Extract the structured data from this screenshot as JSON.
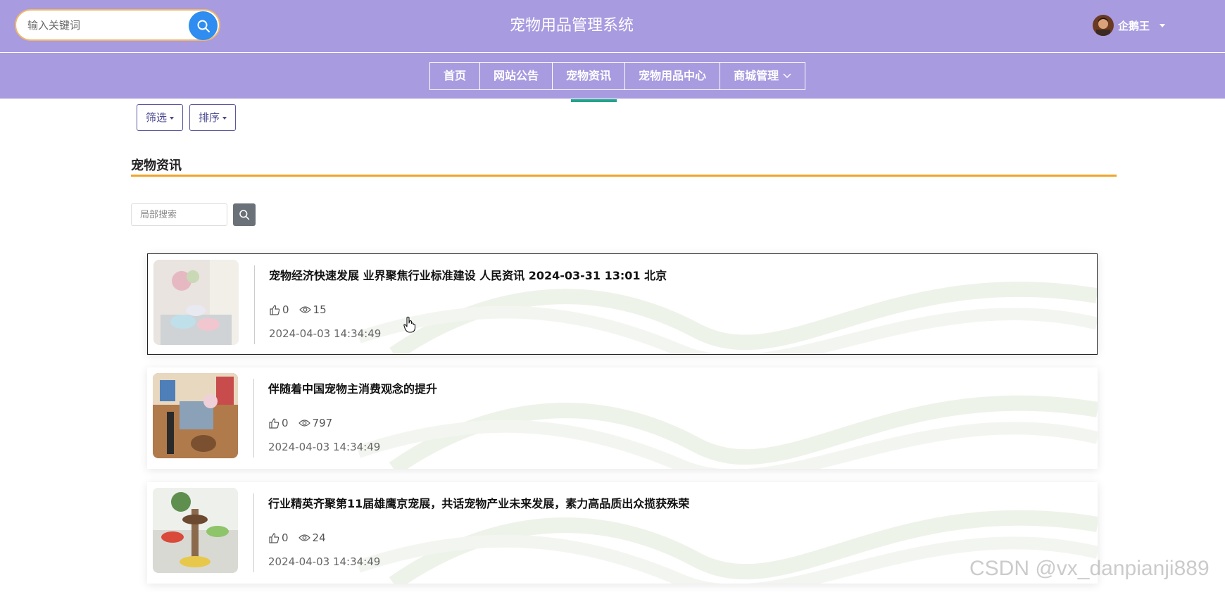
{
  "header": {
    "search_placeholder": "输入关键词",
    "title": "宠物用品管理系统",
    "user_name": "企鹅王"
  },
  "nav": {
    "items": [
      {
        "label": "首页"
      },
      {
        "label": "网站公告"
      },
      {
        "label": "宠物资讯",
        "active": true
      },
      {
        "label": "宠物用品中心"
      },
      {
        "label": "商城管理"
      }
    ]
  },
  "toolbar": {
    "filter_label": "筛选",
    "sort_label": "排序"
  },
  "section": {
    "title": "宠物资讯",
    "local_search_placeholder": "局部搜索"
  },
  "news": [
    {
      "title": "宠物经济快速发展 业界聚焦行业标准建设 人民资讯 2024-03-31 13:01 北京",
      "likes": "0",
      "views": "15",
      "date": "2024-04-03 14:34:49"
    },
    {
      "title": "伴随着中国宠物主消费观念的提升",
      "likes": "0",
      "views": "797",
      "date": "2024-04-03 14:34:49"
    },
    {
      "title": "行业精英齐聚第11届雄鹰京宠展，共话宠物产业未来发展，素力高品质出众揽获殊荣",
      "likes": "0",
      "views": "24",
      "date": "2024-04-03 14:34:49"
    }
  ],
  "watermark": "CSDN @vx_danpianji889",
  "colors": {
    "header_bg": "#a89be0",
    "accent_orange": "#f0a52a",
    "active_tab_bar": "#21a38c",
    "search_button": "#2f8cf0"
  }
}
